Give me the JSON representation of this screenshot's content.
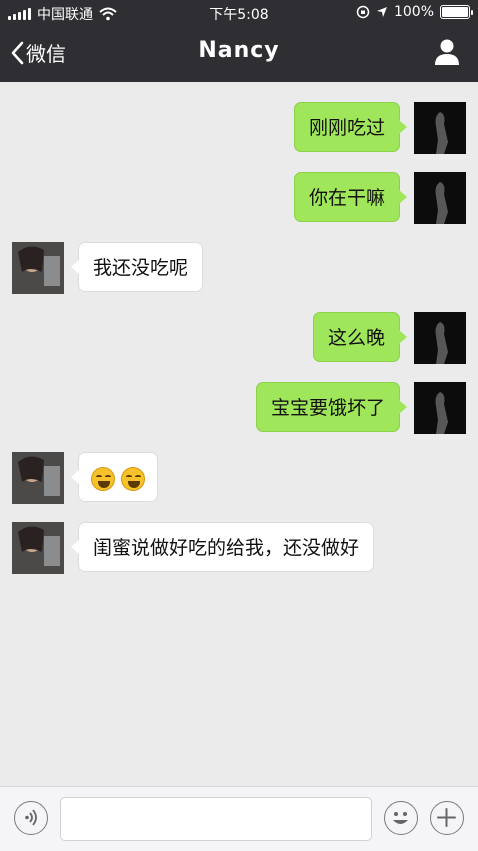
{
  "status_bar": {
    "carrier": "中国联通",
    "time": "下午5:08",
    "battery_text": "100%",
    "battery_level": 1.0
  },
  "nav": {
    "back_label": "微信",
    "title": "Nancy"
  },
  "messages": [
    {
      "side": "out",
      "text": "刚刚吃过"
    },
    {
      "side": "out",
      "text": "你在干嘛"
    },
    {
      "side": "in",
      "text": "我还没吃呢"
    },
    {
      "side": "out",
      "text": "这么晚"
    },
    {
      "side": "out",
      "text": "宝宝要饿坏了"
    },
    {
      "side": "in",
      "emoji": [
        "laughing-tears-emoji",
        "laughing-tears-emoji"
      ]
    },
    {
      "side": "in",
      "text": "闺蜜说做好吃的给我，还没做好"
    }
  ],
  "input_bar": {
    "placeholder": "",
    "icons": [
      "voice-icon",
      "emoji-icon",
      "plus-icon"
    ]
  },
  "colors": {
    "header_bg": "#2f2f33",
    "chat_bg": "#ebebeb",
    "outgoing_bubble": "#9fe65a",
    "incoming_bubble": "#ffffff"
  }
}
